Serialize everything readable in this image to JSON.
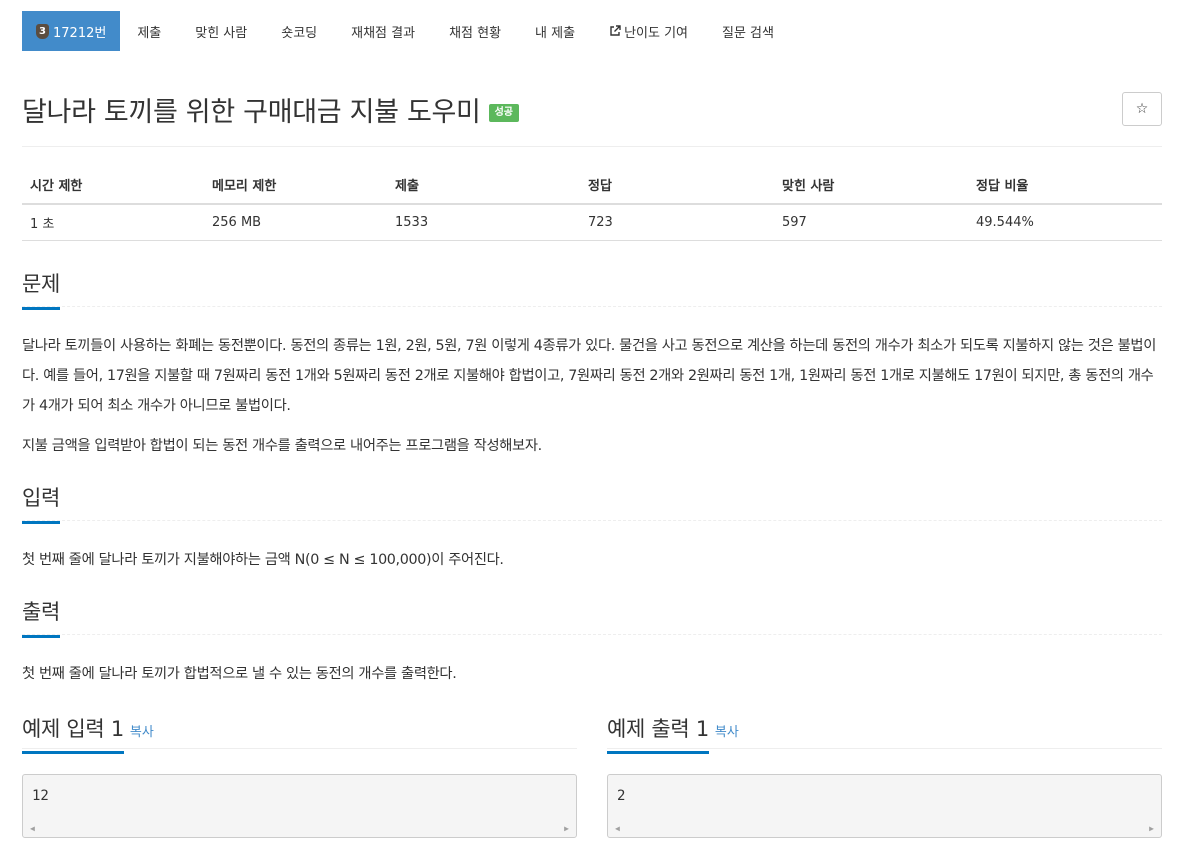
{
  "nav": {
    "problem_tier": "3",
    "problem_number": "17212번",
    "items": [
      "제출",
      "맞힌 사람",
      "숏코딩",
      "재채점 결과",
      "채점 현황",
      "내 제출",
      "난이도 기여",
      "질문 검색"
    ]
  },
  "problem": {
    "title": "달나라 토끼를 위한 구매대금 지불 도우미",
    "status_badge": "성공"
  },
  "stats": {
    "headers": [
      "시간 제한",
      "메모리 제한",
      "제출",
      "정답",
      "맞힌 사람",
      "정답 비율"
    ],
    "values": [
      "1 초",
      "256 MB",
      "1533",
      "723",
      "597",
      "49.544%"
    ]
  },
  "sections": {
    "description": {
      "heading": "문제",
      "paragraphs": [
        "달나라 토끼들이 사용하는 화폐는 동전뿐이다. 동전의 종류는 1원, 2원, 5원, 7원 이렇게 4종류가 있다. 물건을 사고 동전으로 계산을 하는데 동전의 개수가 최소가 되도록 지불하지 않는 것은 불법이다. 예를 들어, 17원을 지불할 때 7원짜리 동전 1개와 5원짜리 동전 2개로 지불해야 합법이고, 7원짜리 동전 2개와 2원짜리 동전 1개, 1원짜리 동전 1개로 지불해도 17원이 되지만, 총 동전의 개수가 4개가 되어 최소 개수가 아니므로 불법이다.",
        "지불 금액을 입력받아 합법이 되는 동전 개수를 출력으로 내어주는 프로그램을 작성해보자."
      ]
    },
    "input": {
      "heading": "입력",
      "text": "첫 번째 줄에 달나라 토끼가 지불해야하는 금액 N(0 ≤ N ≤ 100,000)이 주어진다."
    },
    "output": {
      "heading": "출력",
      "text": "첫 번째 줄에 달나라 토끼가 합법적으로 낼 수 있는 동전의 개수를 출력한다."
    }
  },
  "samples": {
    "input": {
      "heading": "예제 입력 1",
      "copy_label": "복사",
      "value": "12"
    },
    "output": {
      "heading": "예제 출력 1",
      "copy_label": "복사",
      "value": "2"
    }
  },
  "colors": {
    "nav_active": "#428bca",
    "success": "#5cb85c",
    "section_underline": "#0076c0",
    "link": "#428bca"
  }
}
